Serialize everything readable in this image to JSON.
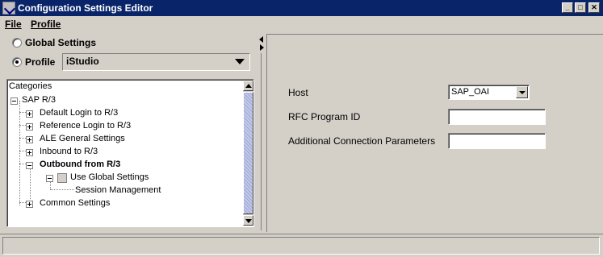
{
  "window": {
    "title": "Configuration Settings Editor",
    "controls": {
      "minimize": "_",
      "maximize": "□",
      "close": "✕"
    }
  },
  "menu": {
    "file": "File",
    "profile": "Profile"
  },
  "left": {
    "global_settings_label": "Global Settings",
    "profile_label": "Profile",
    "profile_value": "iStudio",
    "tree": {
      "root_label": "Categories",
      "sap_r3": "SAP R/3",
      "items": {
        "default_login": "Default Login to R/3",
        "reference_login": "Reference Login to R/3",
        "ale_general": "ALE General Settings",
        "inbound": "Inbound to R/3",
        "outbound": "Outbound from R/3",
        "use_global": "Use Global Settings",
        "session_mgmt": "Session Management",
        "common": "Common Settings"
      }
    }
  },
  "right": {
    "host_label": "Host",
    "host_value": "SAP_OAI",
    "rfc_label": "RFC Program ID",
    "rfc_value": "",
    "params_label": "Additional Connection Parameters",
    "params_value": ""
  },
  "icons": {
    "app": "app-icon",
    "expander": "tree-expander-icon",
    "scroll_up": "scroll-up-icon",
    "scroll_down": "scroll-down-icon",
    "dropdown": "chevron-down-icon"
  },
  "colors": {
    "titlebar": "#0a246a",
    "window_bg": "#d4d0c8",
    "scroll_thumb": "#9da6d6"
  }
}
